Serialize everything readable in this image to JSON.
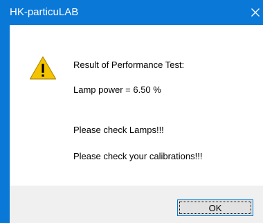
{
  "window": {
    "title": "HK-particuLAB"
  },
  "icons": {
    "close": "close-icon",
    "warning": "warning-icon"
  },
  "message": {
    "heading": "Result of Performance Test:",
    "lamp_power": "Lamp power = 6.50 %",
    "check_lamps": "Please check Lamps!!!",
    "check_calibrations": "Please check your calibrations!!!"
  },
  "buttons": {
    "ok_label": "OK"
  },
  "colors": {
    "titlebar": "#0a78d7",
    "footer": "#f0f0f0",
    "warning_fill": "#f5c400",
    "button_border": "#0078d7"
  }
}
